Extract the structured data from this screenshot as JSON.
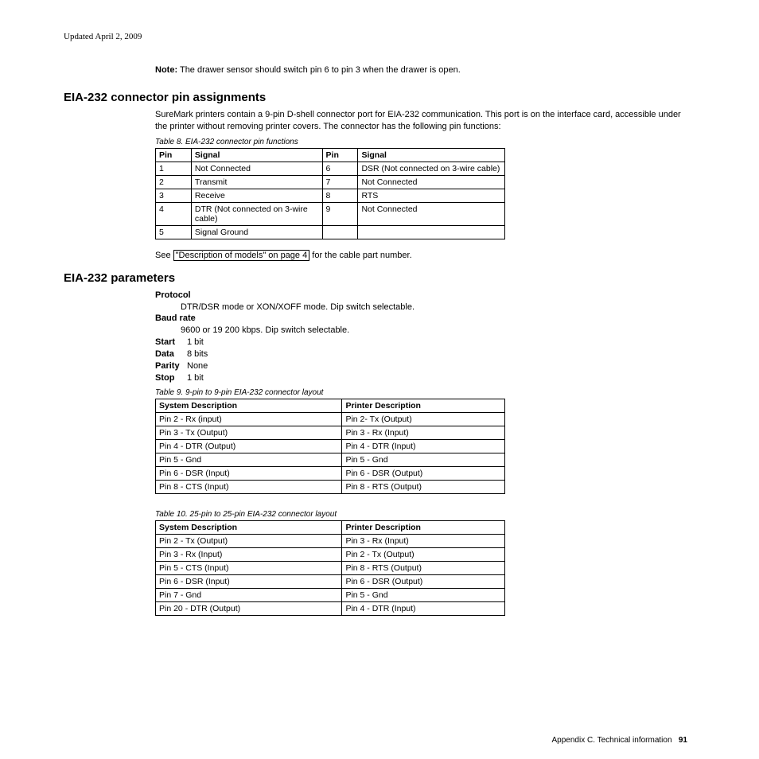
{
  "updated": "Updated April 2, 2009",
  "note": {
    "label": "Note:",
    "text": "The drawer sensor should switch pin 6 to pin 3 when the drawer is open."
  },
  "sec1": {
    "heading": "EIA-232 connector pin assignments",
    "para": "SureMark printers contain a 9-pin D-shell connector port for EIA-232 communication. This port is on the interface card, accessible under the printer without removing printer covers. The connector has the following pin functions:",
    "caption": "Table 8. EIA-232 connector pin functions",
    "headers": {
      "pin1": "Pin",
      "sig1": "Signal",
      "pin2": "Pin",
      "sig2": "Signal"
    },
    "rows": [
      {
        "p1": "1",
        "s1": "Not Connected",
        "p2": "6",
        "s2": "DSR (Not connected on 3-wire cable)"
      },
      {
        "p1": "2",
        "s1": "Transmit",
        "p2": "7",
        "s2": "Not Connected"
      },
      {
        "p1": "3",
        "s1": "Receive",
        "p2": "8",
        "s2": "RTS"
      },
      {
        "p1": "4",
        "s1": "DTR (Not connected on 3-wire cable)",
        "p2": "9",
        "s2": "Not Connected"
      },
      {
        "p1": "5",
        "s1": "Signal Ground",
        "p2": "",
        "s2": ""
      }
    ],
    "see_pre": "See ",
    "see_link": "\"Description of models\" on page 4",
    "see_post": " for the cable part number."
  },
  "sec2": {
    "heading": "EIA-232 parameters",
    "defs": {
      "protocol_lbl": "Protocol",
      "protocol_val": "DTR/DSR mode or XON/XOFF mode. Dip switch selectable.",
      "baud_lbl": "Baud rate",
      "baud_val": "9600 or 19 200 kbps. Dip switch selectable.",
      "start_lbl": "Start",
      "start_val": "1 bit",
      "data_lbl": "Data",
      "data_val": "8 bits",
      "parity_lbl": "Parity",
      "parity_val": "None",
      "stop_lbl": "Stop",
      "stop_val": "1 bit"
    },
    "t9": {
      "caption": "Table 9. 9-pin to 9-pin EIA-232 connector layout",
      "h1": "System Description",
      "h2": "Printer Description",
      "rows": [
        [
          "Pin 2 - Rx (input)",
          "Pin 2- Tx (Output)"
        ],
        [
          "Pin 3 - Tx (Output)",
          "Pin 3 - Rx (Input)"
        ],
        [
          "Pin 4 - DTR (Output)",
          "Pin 4 - DTR (Input)"
        ],
        [
          "Pin 5 - Gnd",
          "Pin 5 - Gnd"
        ],
        [
          "Pin 6 - DSR (Input)",
          "Pin 6 - DSR (Output)"
        ],
        [
          "Pin 8 - CTS (Input)",
          "Pin 8 - RTS (Output)"
        ]
      ]
    },
    "t10": {
      "caption": "Table 10. 25-pin to 25-pin EIA-232 connector layout",
      "h1": "System Description",
      "h2": "Printer Description",
      "rows": [
        [
          "Pin 2 - Tx (Output)",
          "Pin 3 - Rx (Input)"
        ],
        [
          "Pin 3 - Rx (Input)",
          "Pin 2 - Tx (Output)"
        ],
        [
          "Pin 5 - CTS (Input)",
          "Pin 8 - RTS (Output)"
        ],
        [
          "Pin 6 - DSR (Input)",
          "Pin 6 - DSR (Output)"
        ],
        [
          "Pin 7 - Gnd",
          "Pin 5 - Gnd"
        ],
        [
          "Pin 20 - DTR (Output)",
          "Pin 4 - DTR (Input)"
        ]
      ]
    }
  },
  "footer": {
    "text": "Appendix C. Technical information",
    "page": "91"
  }
}
